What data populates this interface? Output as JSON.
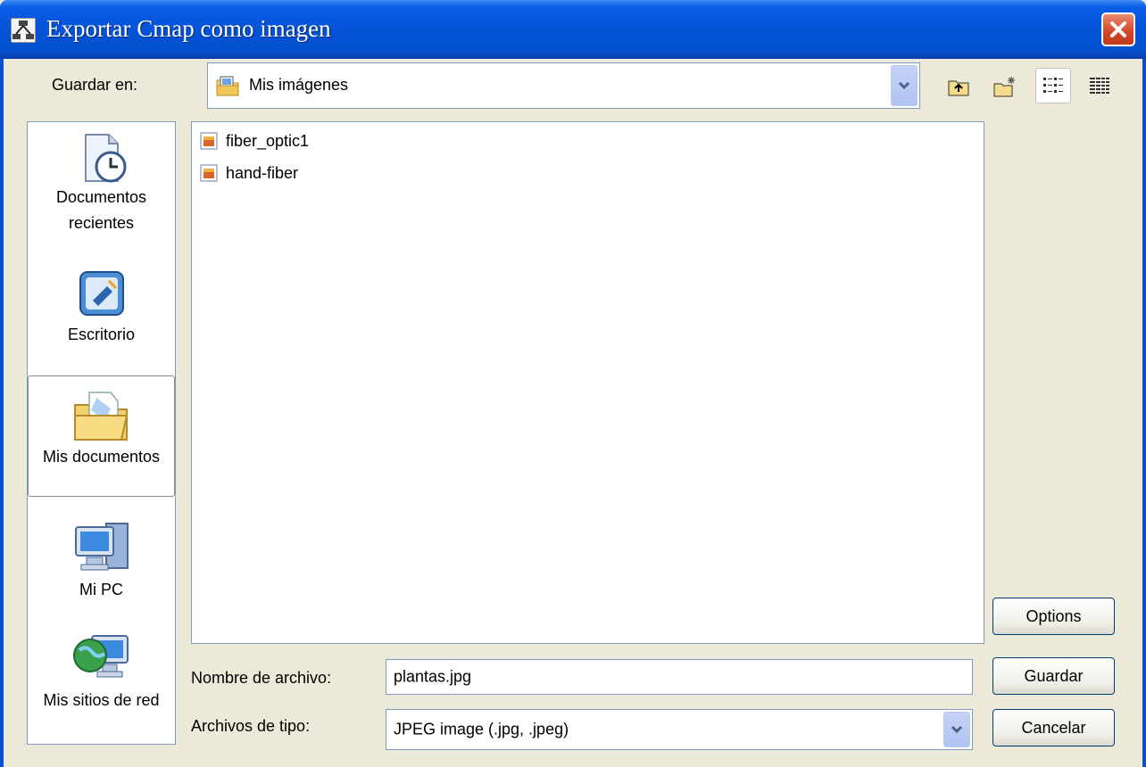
{
  "window": {
    "title": "Exportar Cmap como imagen",
    "close_icon": "close-icon"
  },
  "lookin": {
    "label": "Guardar en:",
    "value": "Mis imágenes",
    "icon": "pictures-folder-icon"
  },
  "toolbar": {
    "icons": [
      "up-folder-icon",
      "new-folder-icon",
      "list-view-icon",
      "details-view-icon"
    ]
  },
  "places": [
    {
      "label_line1": "Documentos",
      "label_line2": "recientes",
      "icon": "recent-documents-icon"
    },
    {
      "label_line1": "Escritorio",
      "icon": "desktop-icon"
    },
    {
      "label_line1": "Mis documentos",
      "icon": "my-documents-icon",
      "selected": true
    },
    {
      "label_line1": "Mi PC",
      "icon": "my-computer-icon"
    },
    {
      "label_line1": "Mis sitios de red",
      "icon": "network-places-icon"
    }
  ],
  "files": [
    {
      "name": "fiber_optic1",
      "icon": "image-file-icon"
    },
    {
      "name": "hand-fiber",
      "icon": "image-file-icon"
    }
  ],
  "filename": {
    "label": "Nombre de archivo:",
    "value": "plantas.jpg"
  },
  "filetype": {
    "label": "Archivos de tipo:",
    "value": "JPEG image (.jpg, .jpeg)"
  },
  "buttons": {
    "options": "Options",
    "save": "Guardar",
    "cancel": "Cancelar"
  },
  "colors": {
    "titlebar": "#0553d8",
    "dialog_bg": "#ece9d8",
    "close_button": "#d1452a"
  }
}
